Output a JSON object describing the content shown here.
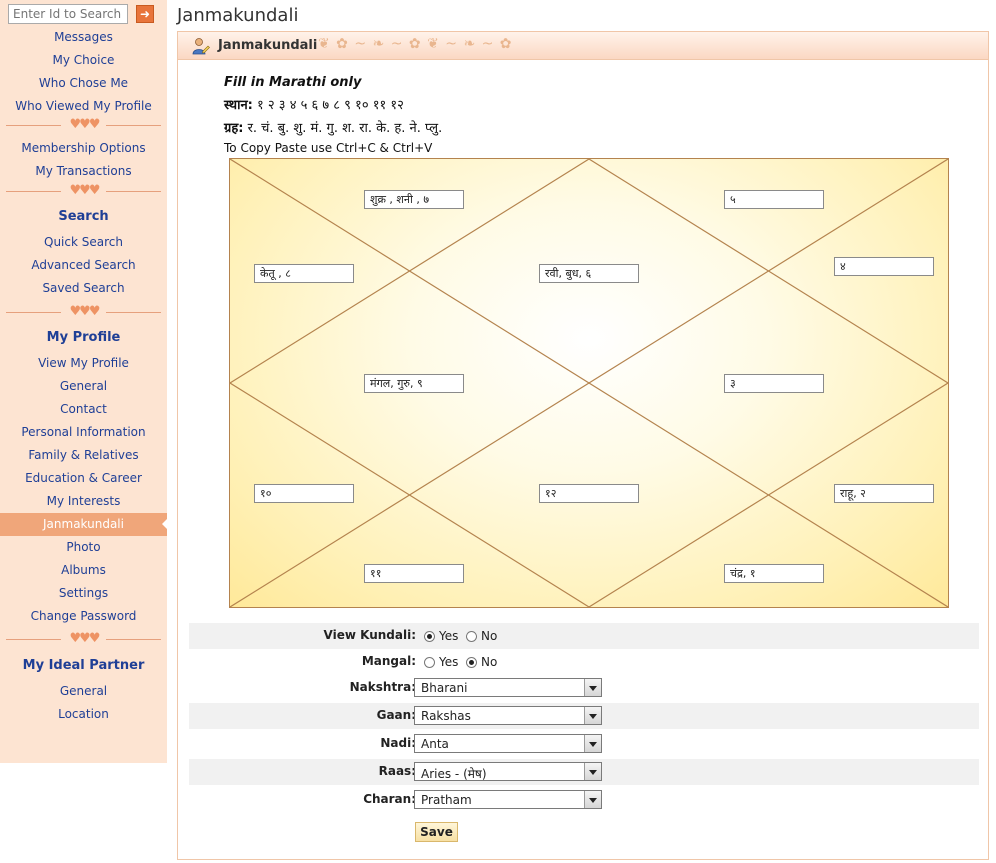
{
  "search": {
    "placeholder": "Enter Id to Search",
    "go_icon": "arrow-right-icon"
  },
  "sidebar": {
    "group1": [
      "Messages",
      "My Choice",
      "Who Chose Me",
      "Who Viewed My Profile"
    ],
    "group2": [
      "Membership Options",
      "My Transactions"
    ],
    "search_section": {
      "title": "Search",
      "items": [
        "Quick Search",
        "Advanced Search",
        "Saved Search"
      ]
    },
    "profile_section": {
      "title": "My Profile",
      "items": [
        "View My Profile",
        "General",
        "Contact",
        "Personal Information",
        "Family & Relatives",
        "Education & Career",
        "My Interests",
        "Janmakundali",
        "Photo",
        "Albums",
        "Settings",
        "Change Password"
      ],
      "active": "Janmakundali"
    },
    "partner_section": {
      "title": "My Ideal Partner",
      "items": [
        "General",
        "Location"
      ]
    }
  },
  "page": {
    "title": "Janmakundali"
  },
  "panel": {
    "title": "Janmakundali",
    "instructions": {
      "line1": "Fill in Marathi only",
      "sthan_label": "स्थान:",
      "sthan_values": " १ २ ३ ४ ५ ६ ७ ८ ९ १० ११ १२",
      "grah_label": "ग्रह:",
      "grah_values": " र. चं. बु. शु. मं. गु. श. रा. के. ह. ने. प्लु.",
      "line4": "To Copy Paste use Ctrl+C & Ctrl+V"
    },
    "houses": {
      "h1": "शुक्र , शनी , ७",
      "h2": "५",
      "h3": "केतू , ८",
      "h4": "रवी, बुध, ६",
      "h5": "४",
      "h6": "मंगल, गुरु, ९",
      "h7": "३",
      "h8": "१०",
      "h9": "१२",
      "h10": "राहू, २",
      "h11": "११",
      "h12": "चंद्र, १"
    }
  },
  "form": {
    "view_kundali": {
      "label": "View Kundali:",
      "options": [
        "Yes",
        "No"
      ],
      "selected": "Yes"
    },
    "mangal": {
      "label": "Mangal:",
      "options": [
        "Yes",
        "No"
      ],
      "selected": "No"
    },
    "nakshtra": {
      "label": "Nakshtra:",
      "value": "Bharani"
    },
    "gaan": {
      "label": "Gaan:",
      "value": "Rakshas"
    },
    "nadi": {
      "label": "Nadi:",
      "value": "Anta"
    },
    "raas": {
      "label": "Raas:",
      "value": "Aries - (मेष)"
    },
    "charan": {
      "label": "Charan:",
      "value": "Pratham"
    },
    "save_label": "Save"
  },
  "colors": {
    "sidebar_bg": "#fde4d2",
    "link": "#1f3f96",
    "active_item": "#f0a67a",
    "chart_line": "#b4834e",
    "chart_fill": "#fff1b8"
  }
}
